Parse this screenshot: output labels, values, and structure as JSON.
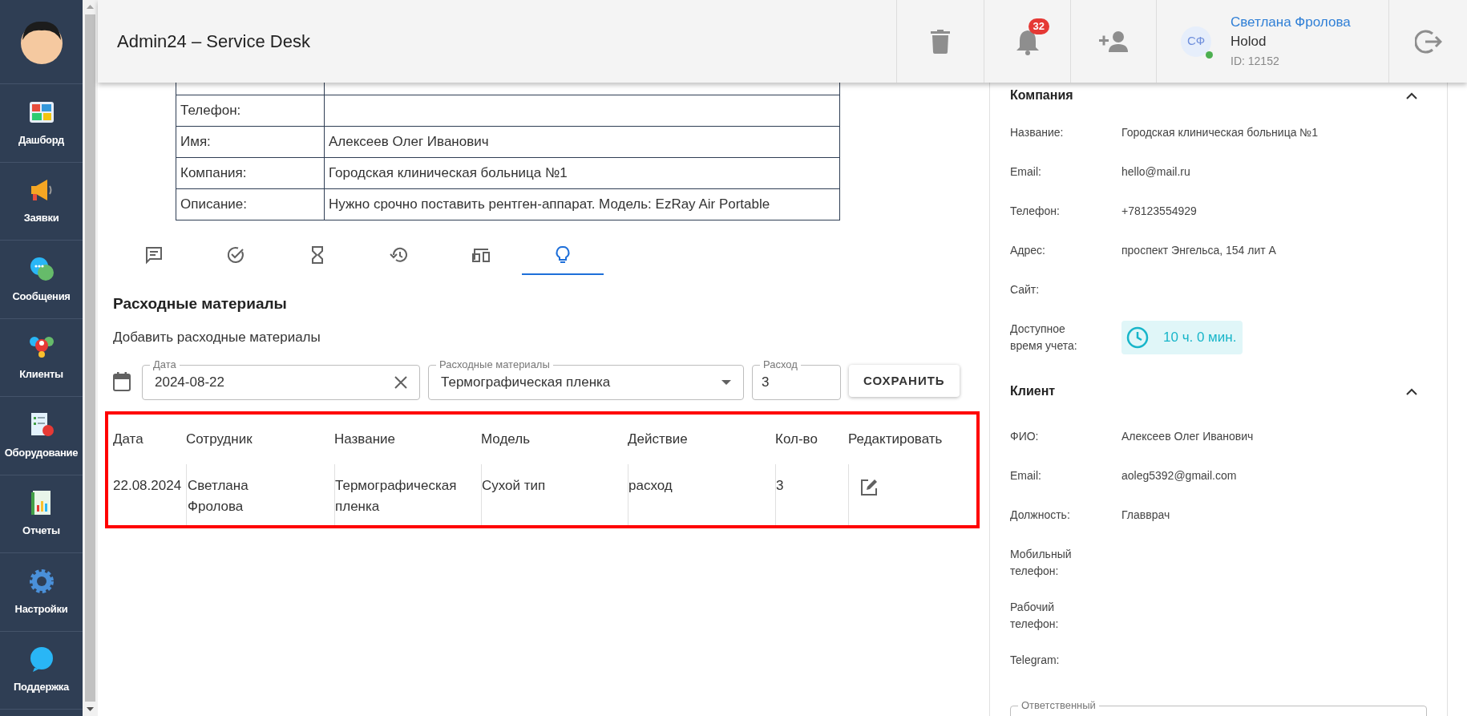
{
  "sidebar": {
    "items": [
      {
        "kind": "dashboard",
        "label": "Дашборд"
      },
      {
        "kind": "requests",
        "label": "Заявки"
      },
      {
        "kind": "messages",
        "label": "Сообщения"
      },
      {
        "kind": "clients",
        "label": "Клиенты"
      },
      {
        "kind": "equipment",
        "label": "Оборудование"
      },
      {
        "kind": "reports",
        "label": "Отчеты"
      },
      {
        "kind": "settings",
        "label": "Настройки"
      },
      {
        "kind": "support",
        "label": "Поддержка"
      }
    ]
  },
  "header": {
    "title": "Admin24 – Service Desk",
    "notification_count": "32",
    "user": {
      "initials": "СФ",
      "name": "Светлана Фролова",
      "company": "Holod",
      "id": "ID: 12152",
      "online": true
    }
  },
  "request_info": {
    "rows": [
      {
        "label": "Телефон:"
      },
      {
        "label": "Имя:",
        "value": "Алексеев Олег Иванович"
      },
      {
        "label": "Компания:",
        "value": "Городская клиническая больница №1"
      },
      {
        "label": "Описание:",
        "value": "Нужно срочно поставить рентген-аппарат. Модель: EzRay Air Portable"
      }
    ]
  },
  "tabs": [
    {
      "kind": "comments",
      "selected": false
    },
    {
      "kind": "tasks",
      "selected": false
    },
    {
      "kind": "time",
      "selected": false
    },
    {
      "kind": "history",
      "selected": false
    },
    {
      "kind": "devices",
      "selected": false
    },
    {
      "kind": "consumables",
      "selected": true
    }
  ],
  "consumables": {
    "title": "Расходные материалы",
    "subtitle": "Добавить расходные материалы",
    "date_field": {
      "label": "Дата",
      "value": "2024-08-22"
    },
    "material_field": {
      "label": "Расходные материалы",
      "value": "Термографическая пленка"
    },
    "amount_field": {
      "label": "Расход",
      "value": "3"
    },
    "save_button": "СОХРАНИТЬ",
    "table": {
      "highlighted": true,
      "columns": [
        "Дата",
        "Сотрудник",
        "Название",
        "Модель",
        "Действие",
        "Кол-во",
        "Редактировать"
      ],
      "rows": [
        {
          "cells": [
            "22.08.2024",
            "Светлана Фролова",
            "Термографическая пленка",
            "Сухой тип",
            "расход",
            "3"
          ]
        }
      ]
    }
  },
  "company": {
    "title": "Компания",
    "expanded": true,
    "fields": [
      {
        "label": "Название:",
        "value": "Городская клиническая больница №1"
      },
      {
        "label": "Email:",
        "value": "hello@mail.ru"
      },
      {
        "label": "Телефон:",
        "value": "+78123554929"
      },
      {
        "label": "Адрес:",
        "value": "проспект Энгельса, 154 лит А"
      },
      {
        "label": "Сайт:"
      }
    ],
    "time": {
      "label": "Доступное время учета:",
      "value": "10 ч. 0 мин."
    }
  },
  "client": {
    "title": "Клиент",
    "expanded": true,
    "fields": [
      {
        "label": "ФИО:",
        "value": "Алексеев Олег Иванович"
      },
      {
        "label": "Email:",
        "value": "aoleg5392@gmail.com"
      },
      {
        "label": "Должность:",
        "value": "Главврач"
      },
      {
        "label": "Мобильный телефон:"
      },
      {
        "label": "Рабочий телефон:"
      },
      {
        "label": "Telegram:"
      }
    ]
  },
  "responsible": {
    "label": "Ответственный"
  }
}
